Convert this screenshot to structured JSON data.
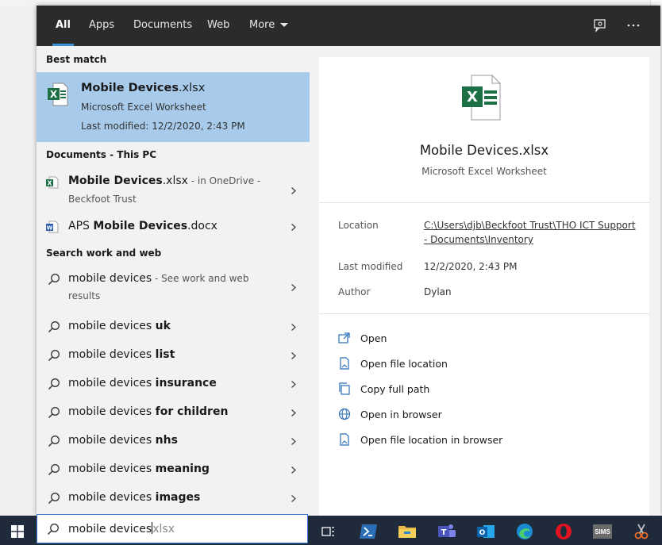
{
  "tabs": [
    {
      "label": "All"
    },
    {
      "label": "Apps"
    },
    {
      "label": "Documents"
    },
    {
      "label": "Web"
    },
    {
      "label": "More"
    }
  ],
  "best_match": {
    "heading": "Best match",
    "title_bold": "Mobile Devices",
    "title_rest": ".xlsx",
    "type": "Microsoft Excel Worksheet",
    "modified": "Last modified: 12/2/2020, 2:43 PM"
  },
  "documents": {
    "heading": "Documents - This PC",
    "items": [
      {
        "bold": "Mobile Devices",
        "rest": ".xlsx",
        "sub": " - in OneDrive -",
        "sub2": "Beckfoot Trust"
      },
      {
        "pre": "APS ",
        "bold": "Mobile Devices",
        "rest": ".docx"
      }
    ]
  },
  "web": {
    "heading": "Search work and web",
    "items": [
      {
        "plain": "mobile devices",
        "sub": " - See work and web",
        "sub2": "results"
      },
      {
        "plain": "mobile devices ",
        "bold": "uk"
      },
      {
        "plain": "mobile devices ",
        "bold": "list"
      },
      {
        "plain": "mobile devices ",
        "bold": "insurance"
      },
      {
        "plain": "mobile devices ",
        "bold": "for children"
      },
      {
        "plain": "mobile devices ",
        "bold": "nhs"
      },
      {
        "plain": "mobile devices ",
        "bold": "meaning"
      },
      {
        "plain": "mobile devices ",
        "bold": "images"
      }
    ]
  },
  "preview": {
    "title": "Mobile Devices.xlsx",
    "type": "Microsoft Excel Worksheet",
    "location_label": "Location",
    "location_line1": "C:\\Users\\djb\\Beckfoot Trust\\THO ICT Support",
    "location_line2": "- Documents\\Inventory",
    "modified_label": "Last modified",
    "modified_value": "12/2/2020, 2:43 PM",
    "author_label": "Author",
    "author_value": "Dylan",
    "actions": [
      {
        "label": "Open",
        "icon": "open-icon"
      },
      {
        "label": "Open file location",
        "icon": "file-location-icon"
      },
      {
        "label": "Copy full path",
        "icon": "copy-icon"
      },
      {
        "label": "Open in browser",
        "icon": "globe-icon"
      },
      {
        "label": "Open file location in browser",
        "icon": "file-location-icon"
      }
    ]
  },
  "search": {
    "typed": "mobile devices",
    "suggestion": "xlsx"
  },
  "taskbar": {
    "apps": [
      "task-view",
      "powershell",
      "file-explorer",
      "teams",
      "outlook",
      "edge",
      "opera",
      "sims",
      "snipping-tool"
    ],
    "sims_label": "SIMS"
  },
  "colors": {
    "topbar": "#2b2b2b",
    "accent": "#3b8fd6",
    "best_match_bg": "#a8cbeb",
    "excel_green": "#1d7044",
    "taskbar": "#1f2a3a"
  }
}
